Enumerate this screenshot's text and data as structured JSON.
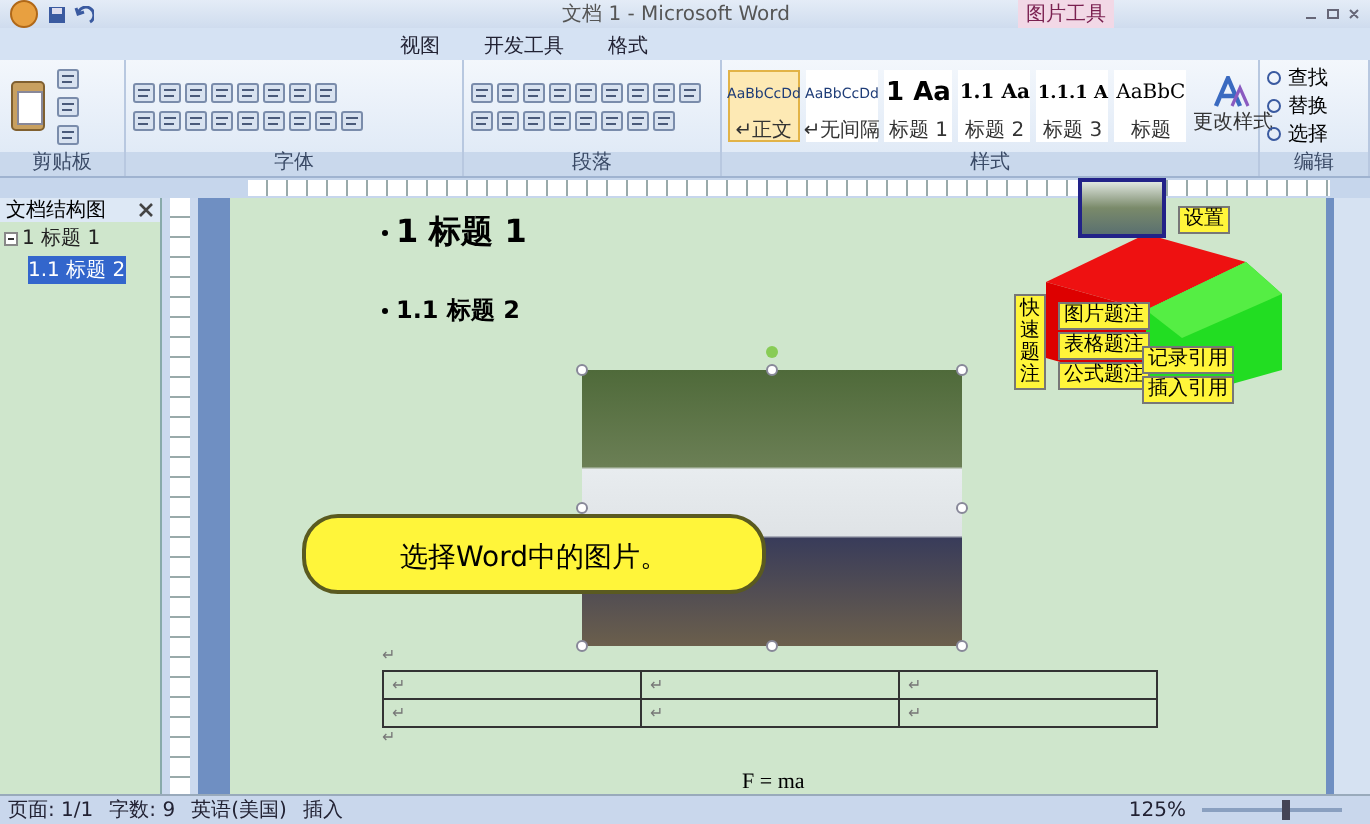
{
  "title_bar": {
    "title": "文档 1 - Microsoft Word",
    "context_tab": "图片工具"
  },
  "tabs": [
    {
      "label": "视图",
      "selected": false
    },
    {
      "label": "开发工具",
      "selected": false
    },
    {
      "label": "格式",
      "selected": false
    }
  ],
  "ribbon": {
    "groups": [
      {
        "label": "剪贴板",
        "kind": "clipboard"
      },
      {
        "label": "字体",
        "kind": "font"
      },
      {
        "label": "段落",
        "kind": "paragraph"
      },
      {
        "label": "样式",
        "kind": "styles"
      },
      {
        "label": "编辑",
        "kind": "editing"
      }
    ],
    "styles": [
      {
        "preview": "AaBbCcDd",
        "name": "↵正文",
        "selected": true
      },
      {
        "preview": "AaBbCcDd",
        "name": "↵无间隔",
        "selected": false
      },
      {
        "preview": "1 Aa",
        "name": "标题 1",
        "selected": false
      },
      {
        "preview": "1.1 Aa",
        "name": "标题 2",
        "selected": false
      },
      {
        "preview": "1.1.1 A",
        "name": "标题 3",
        "selected": false
      },
      {
        "preview": "AaBbC",
        "name": "标题",
        "selected": false
      }
    ],
    "change_styles": "更改样式",
    "editing": [
      "查找",
      "替换",
      "选择"
    ]
  },
  "nav_pane": {
    "title": "文档结构图",
    "items": [
      {
        "label": "1 标题 1",
        "expanded": true,
        "selected": false,
        "children": [
          {
            "label": "1.1 标题 2",
            "selected": true
          }
        ]
      }
    ]
  },
  "document": {
    "heading1": "1 标题 1",
    "heading2": "1.1 标题 2",
    "callout": "选择Word中的图片。",
    "table": {
      "rows": [
        [
          "↵",
          "↵",
          "↵"
        ],
        [
          "↵",
          "↵",
          "↵"
        ]
      ]
    },
    "formula": "F = ma",
    "para_marks": [
      "↵",
      "↵"
    ]
  },
  "overlay": {
    "title": "快速题注",
    "buttons": [
      "图片题注",
      "表格题注",
      "公式题注"
    ],
    "links": [
      "记录引用",
      "插入引用"
    ],
    "settings": "设置"
  },
  "status_bar": [
    "页面: 1/1",
    "字数: 9",
    "英语(美国)",
    "插入"
  ],
  "zoom": "125%",
  "zoom_slider": {
    "level": 0.6
  }
}
